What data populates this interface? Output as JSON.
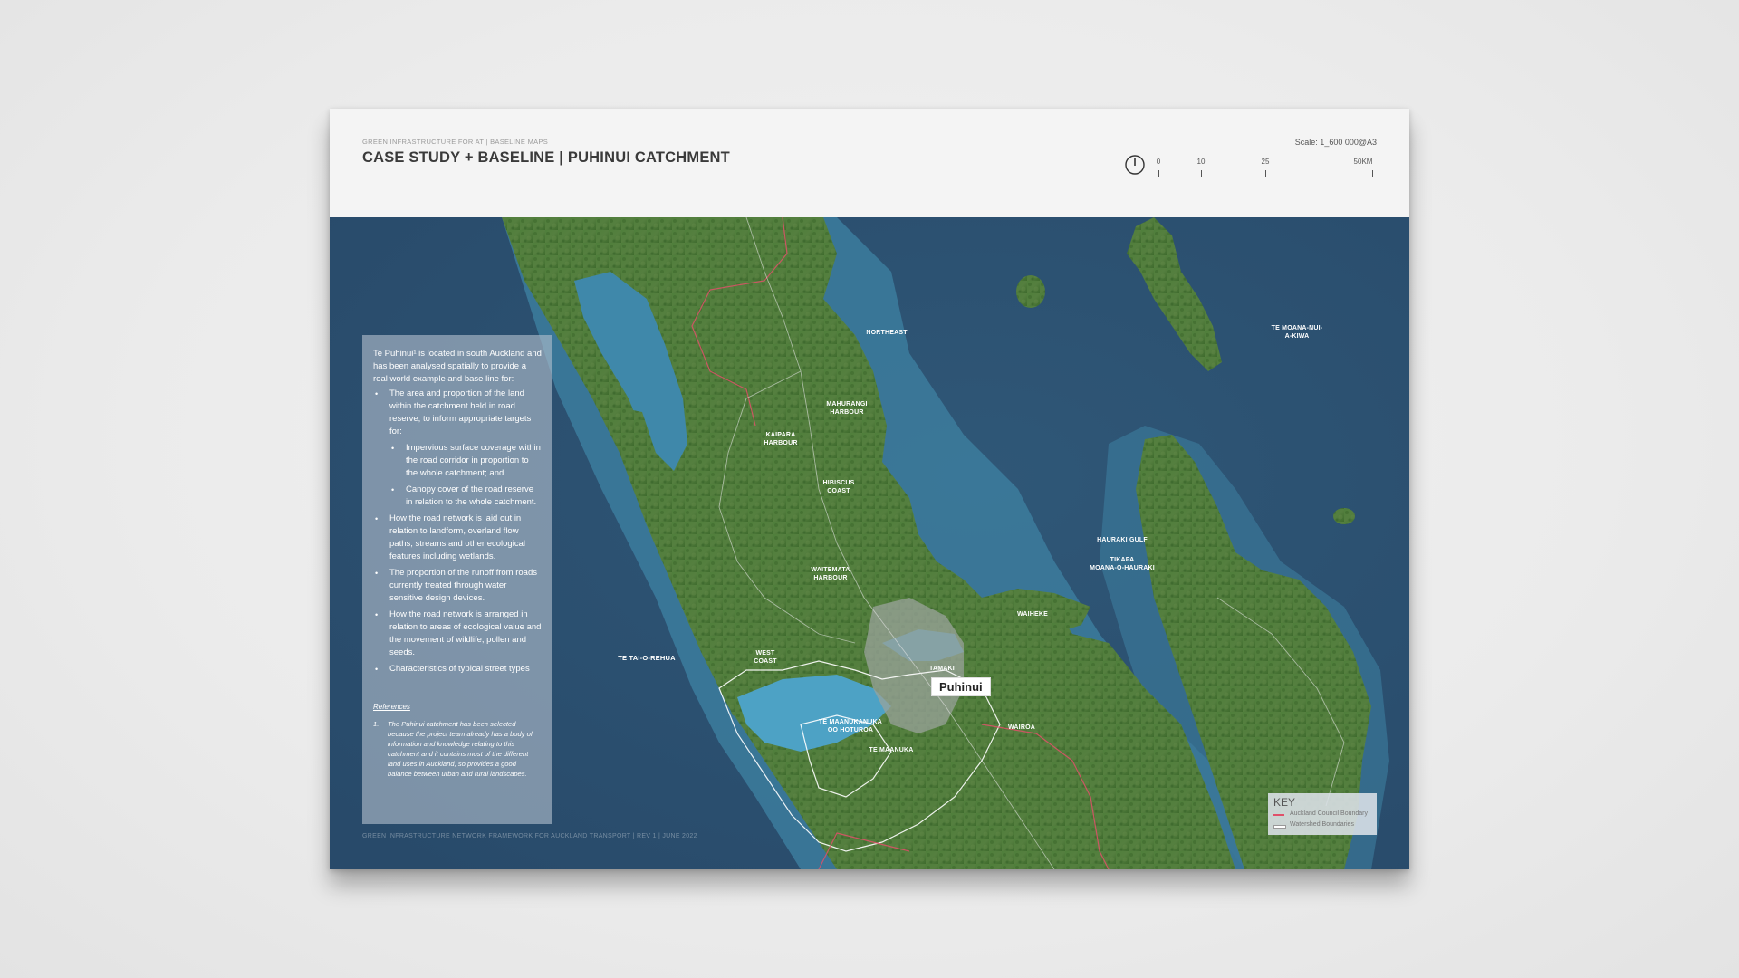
{
  "sheet": {
    "subtitle": "GREEN INFRASTRUCTURE FOR AT | BASELINE MAPS",
    "title": "CASE STUDY + BASELINE | PUHINUI CATCHMENT",
    "scale_text": "Scale: 1_600 000@A3",
    "scalebar": {
      "labels": [
        "0",
        "10",
        "25",
        "50KM"
      ]
    },
    "footer": "GREEN INFRASTRUCTURE NETWORK FRAMEWORK FOR AUCKLAND TRANSPORT | Rev 1 | June 2022"
  },
  "panel": {
    "intro": "Te Puhinui¹ is located in south Auckland and has been analysed spatially to provide a real world example and base line for:",
    "bullet_1": "The area and proportion of the land within the catchment held in road reserve, to inform appropriate targets for:",
    "sub_bullet_1": "Impervious surface coverage within the road corridor in proportion to the whole catchment; and",
    "sub_bullet_2": "Canopy cover of the road reserve in relation to the whole catchment.",
    "bullet_2": "How the road network is laid out in relation to landform, overland flow paths, streams and other ecological features including wetlands.",
    "bullet_3": "The proportion of the runoff from roads currently treated through water sensitive design devices.",
    "bullet_4": "How the road network is arranged in relation to areas of ecological value and the movement of wildlife, pollen and seeds.",
    "bullet_5": "Characteristics of typical street types",
    "references_title": "References",
    "reference_num": "1.",
    "reference_text": "The Puhinui catchment has been selected because the project team already has a body of information and knowledge relating to this catchment and it contains most of the different land uses in Auckland, so provides a good balance between urban and rural landscapes."
  },
  "map_labels": {
    "northeast": "NORTHEAST",
    "mahurangi": "MAHURANGI\nHARBOUR",
    "kaipara": "KAIPARA\nHARBOUR",
    "hibiscus": "HIBISCUS\nCOAST",
    "waitemata": "WAITEMATA\nHARBOUR",
    "west_coast": "WEST\nCOAST",
    "tamaki": "TAMAKI",
    "waiheke": "WAIHEKE",
    "wairoa": "WAIROA",
    "manukau_maori": "TE MAANUKANUKA\nOO HOTUROA",
    "manuka": "TE MAANUKA",
    "tasman": "TE TAI-O-REHUA",
    "hauraki_gulf": "HAURAKI GULF",
    "tikapa": "TIKAPA\nMOANA-O-HAURAKI",
    "pacific": "TE MOANA-NUI-\nA-KIWA",
    "puhinui": "Puhinui"
  },
  "key": {
    "title": "KEY",
    "items": [
      {
        "label": "Auckland Council Boundary",
        "color": "#e0506a"
      },
      {
        "label": "Watershed Boundaries",
        "color": "#ffffff"
      }
    ]
  },
  "colors": {
    "sea_deep": "#2f5275",
    "sea_shallow": "#3f87a8",
    "land": "#4d7c3a",
    "land_dark": "#3b6a2c",
    "urban": "#9aa49a"
  }
}
